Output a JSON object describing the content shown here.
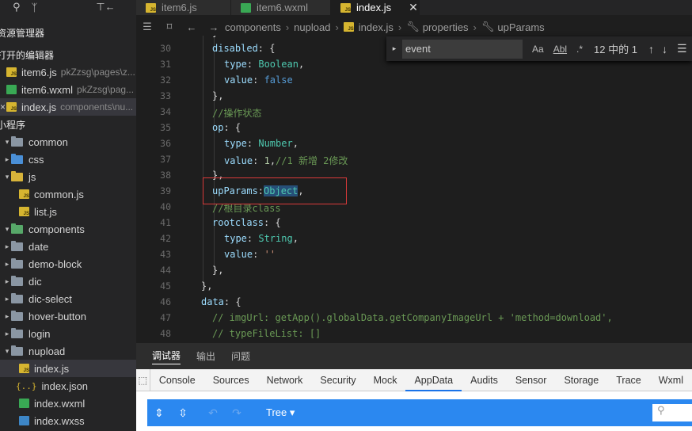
{
  "sidebar": {
    "explorer_title": "资源管理器",
    "open_editors_title": "打开的编辑器",
    "open_editors": [
      {
        "name": "item6.js",
        "path": "pkZzsg\\pages\\z..."
      },
      {
        "name": "item6.wxml",
        "path": "pkZzsg\\pag..."
      },
      {
        "name": "index.js",
        "path": "components\\nu..."
      }
    ],
    "project_title": "小程序",
    "tree": [
      {
        "name": "common"
      },
      {
        "name": "css"
      },
      {
        "name": "js"
      },
      {
        "name": "common.js"
      },
      {
        "name": "list.js"
      },
      {
        "name": "components"
      },
      {
        "name": "date"
      },
      {
        "name": "demo-block"
      },
      {
        "name": "dic"
      },
      {
        "name": "dic-select"
      },
      {
        "name": "hover-button"
      },
      {
        "name": "login"
      },
      {
        "name": "nupload"
      },
      {
        "name": "index.js"
      },
      {
        "name": "index.json"
      },
      {
        "name": "index.wxml"
      },
      {
        "name": "index.wxss"
      }
    ]
  },
  "tabs": [
    {
      "label": "item6.js"
    },
    {
      "label": "item6.wxml"
    },
    {
      "label": "index.js"
    }
  ],
  "breadcrumb": [
    "components",
    "nupload",
    "index.js",
    "properties",
    "upParams"
  ],
  "find": {
    "value": "event",
    "opt_case": "Aa",
    "opt_word": "Abl",
    "opt_regex": ".*",
    "count": "12 中的 1"
  },
  "editor": {
    "line_numbers": [
      "30",
      "31",
      "32",
      "33",
      "34",
      "35",
      "36",
      "37",
      "38",
      "39",
      "40",
      "41",
      "42",
      "43",
      "44",
      "45",
      "46",
      "47",
      "48"
    ],
    "comment_op": "//操作状态",
    "comment_op_value": "//1 新增 2修改",
    "comment_root": "//根目录class",
    "comment_img": "// imgUrl: getApp().globalData.getCompanyImageUrl + 'method=download',",
    "comment_list": "// typeFileList: []"
  },
  "panel_tabs": [
    "调试器",
    "输出",
    "问题"
  ],
  "devtools_tabs": [
    "Console",
    "Sources",
    "Network",
    "Security",
    "Mock",
    "AppData",
    "Audits",
    "Sensor",
    "Storage",
    "Trace",
    "Wxml"
  ],
  "appdata": {
    "mode_label": "Tree"
  }
}
